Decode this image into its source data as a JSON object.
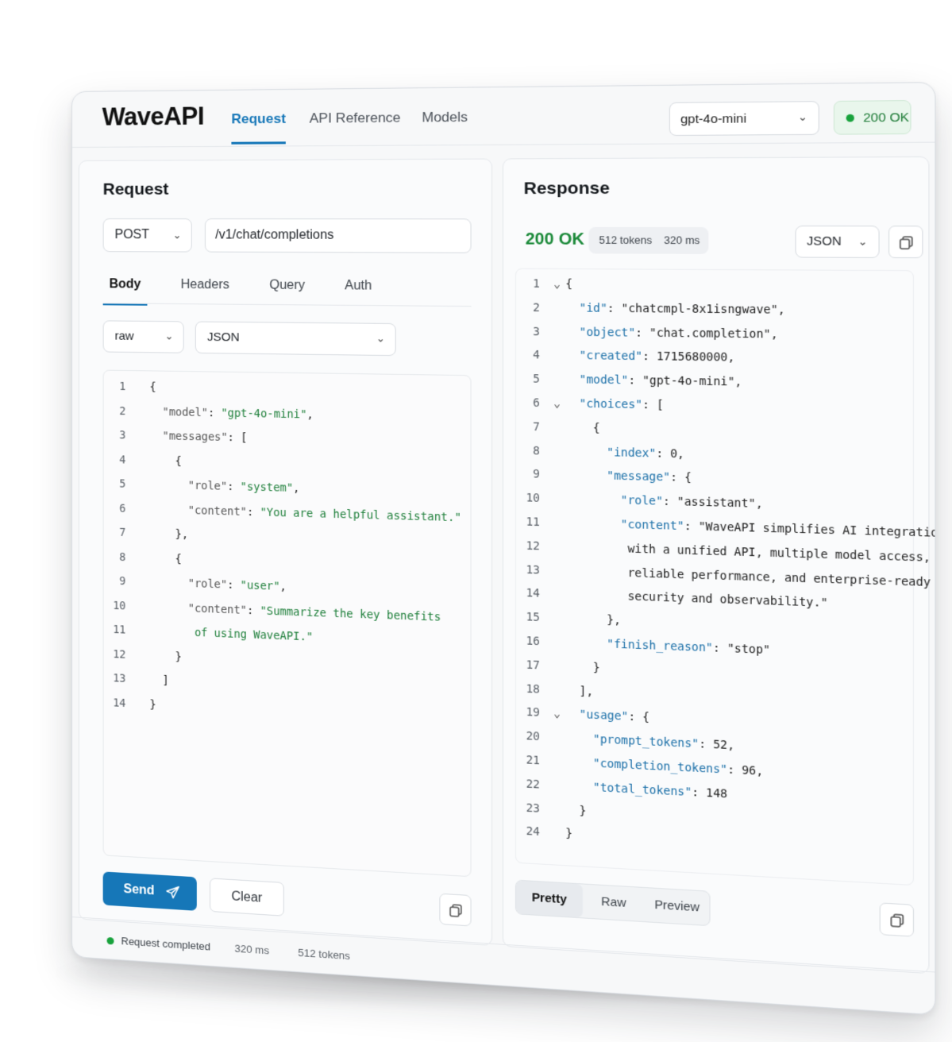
{
  "app": {
    "logo": "WaveAPI"
  },
  "nav": {
    "tabs": [
      {
        "label": "Request"
      },
      {
        "label": "API Reference"
      },
      {
        "label": "Models"
      }
    ]
  },
  "header": {
    "model": "gpt-4o-mini",
    "status": "200 OK"
  },
  "request": {
    "title": "Request",
    "method": "POST",
    "endpoint": "/v1/chat/completions",
    "tabs": [
      {
        "label": "Body"
      },
      {
        "label": "Headers"
      },
      {
        "label": "Query"
      },
      {
        "label": "Auth"
      }
    ],
    "body_mode": "raw",
    "body_format": "JSON",
    "code": [
      {
        "n": "1",
        "parts": [
          {
            "t": "{",
            "c": "p"
          }
        ],
        "indent": 0
      },
      {
        "n": "2",
        "parts": [
          {
            "t": "\"model\"",
            "c": "kg"
          },
          {
            "t": ": ",
            "c": "p"
          },
          {
            "t": "\"gpt-4o-mini\"",
            "c": "s"
          },
          {
            "t": ",",
            "c": "p"
          }
        ],
        "indent": 1
      },
      {
        "n": "3",
        "parts": [
          {
            "t": "\"messages\"",
            "c": "kg"
          },
          {
            "t": ": [",
            "c": "p"
          }
        ],
        "indent": 1
      },
      {
        "n": "4",
        "parts": [
          {
            "t": "{",
            "c": "p"
          }
        ],
        "indent": 2
      },
      {
        "n": "5",
        "parts": [
          {
            "t": "\"role\"",
            "c": "kg"
          },
          {
            "t": ": ",
            "c": "p"
          },
          {
            "t": "\"system\"",
            "c": "s"
          },
          {
            "t": ",",
            "c": "p"
          }
        ],
        "indent": 3
      },
      {
        "n": "6",
        "parts": [
          {
            "t": "\"content\"",
            "c": "kg"
          },
          {
            "t": ": ",
            "c": "p"
          },
          {
            "t": "\"You are a helpful assistant.\"",
            "c": "s"
          }
        ],
        "indent": 3
      },
      {
        "n": "7",
        "parts": [
          {
            "t": "},",
            "c": "p"
          }
        ],
        "indent": 2
      },
      {
        "n": "8",
        "parts": [
          {
            "t": "{",
            "c": "p"
          }
        ],
        "indent": 2
      },
      {
        "n": "9",
        "parts": [
          {
            "t": "\"role\"",
            "c": "kg"
          },
          {
            "t": ": ",
            "c": "p"
          },
          {
            "t": "\"user\"",
            "c": "s"
          },
          {
            "t": ",",
            "c": "p"
          }
        ],
        "indent": 3
      },
      {
        "n": "10",
        "parts": [
          {
            "t": "\"content\"",
            "c": "kg"
          },
          {
            "t": ": ",
            "c": "p"
          },
          {
            "t": "\"Summarize the key benefits",
            "c": "s"
          }
        ],
        "indent": 3
      },
      {
        "n": "11",
        "parts": [
          {
            "t": " of using WaveAPI.\"",
            "c": "s"
          }
        ],
        "indent": 3
      },
      {
        "n": "12",
        "parts": [
          {
            "t": "}",
            "c": "p"
          }
        ],
        "indent": 2
      },
      {
        "n": "13",
        "parts": [
          {
            "t": "]",
            "c": "p"
          }
        ],
        "indent": 1
      },
      {
        "n": "14",
        "parts": [
          {
            "t": "}",
            "c": "p"
          }
        ],
        "indent": 0
      }
    ],
    "send_label": "Send",
    "clear_label": "Clear"
  },
  "response": {
    "title": "Response",
    "status": "200 OK",
    "tokens": "512 tokens",
    "time": "320 ms",
    "format": "JSON",
    "code": [
      {
        "n": "1",
        "fold": "⌄",
        "parts": [
          {
            "t": "{",
            "c": "p"
          }
        ],
        "indent": 0
      },
      {
        "n": "2",
        "parts": [
          {
            "t": "\"id\"",
            "c": "k"
          },
          {
            "t": ": ",
            "c": "p"
          },
          {
            "t": "\"chatcmpl-8x1isngwave\"",
            "c": "p"
          },
          {
            "t": ",",
            "c": "p"
          }
        ],
        "indent": 1
      },
      {
        "n": "3",
        "parts": [
          {
            "t": "\"object\"",
            "c": "k"
          },
          {
            "t": ": ",
            "c": "p"
          },
          {
            "t": "\"chat.completion\"",
            "c": "p"
          },
          {
            "t": ",",
            "c": "p"
          }
        ],
        "indent": 1
      },
      {
        "n": "4",
        "parts": [
          {
            "t": "\"created\"",
            "c": "k"
          },
          {
            "t": ": 1715680000,",
            "c": "p"
          }
        ],
        "indent": 1
      },
      {
        "n": "5",
        "parts": [
          {
            "t": "\"model\"",
            "c": "k"
          },
          {
            "t": ": ",
            "c": "p"
          },
          {
            "t": "\"gpt-4o-mini\"",
            "c": "p"
          },
          {
            "t": ",",
            "c": "p"
          }
        ],
        "indent": 1
      },
      {
        "n": "6",
        "fold": "⌄",
        "parts": [
          {
            "t": "\"choices\"",
            "c": "k"
          },
          {
            "t": ": [",
            "c": "p"
          }
        ],
        "indent": 1
      },
      {
        "n": "7",
        "parts": [
          {
            "t": "{",
            "c": "p"
          }
        ],
        "indent": 2
      },
      {
        "n": "8",
        "parts": [
          {
            "t": "\"index\"",
            "c": "k"
          },
          {
            "t": ": 0,",
            "c": "p"
          }
        ],
        "indent": 3
      },
      {
        "n": "9",
        "parts": [
          {
            "t": "\"message\"",
            "c": "k"
          },
          {
            "t": ": {",
            "c": "p"
          }
        ],
        "indent": 3
      },
      {
        "n": "10",
        "parts": [
          {
            "t": "\"role\"",
            "c": "k"
          },
          {
            "t": ": ",
            "c": "p"
          },
          {
            "t": "\"assistant\"",
            "c": "p"
          },
          {
            "t": ",",
            "c": "p"
          }
        ],
        "indent": 4
      },
      {
        "n": "11",
        "parts": [
          {
            "t": "\"content\"",
            "c": "k"
          },
          {
            "t": ": ",
            "c": "p"
          },
          {
            "t": "\"WaveAPI simplifies AI integration",
            "c": "p"
          }
        ],
        "indent": 4
      },
      {
        "n": "12",
        "parts": [
          {
            "t": " with a unified API, multiple model access,",
            "c": "p"
          }
        ],
        "indent": 4
      },
      {
        "n": "13",
        "parts": [
          {
            "t": " reliable performance, and enterprise-ready",
            "c": "p"
          }
        ],
        "indent": 4
      },
      {
        "n": "14",
        "parts": [
          {
            "t": " security and observability.\"",
            "c": "p"
          }
        ],
        "indent": 4
      },
      {
        "n": "15",
        "parts": [
          {
            "t": "},",
            "c": "p"
          }
        ],
        "indent": 3
      },
      {
        "n": "16",
        "parts": [
          {
            "t": "\"finish_reason\"",
            "c": "k"
          },
          {
            "t": ": ",
            "c": "p"
          },
          {
            "t": "\"stop\"",
            "c": "p"
          }
        ],
        "indent": 3
      },
      {
        "n": "17",
        "parts": [
          {
            "t": "}",
            "c": "p"
          }
        ],
        "indent": 2
      },
      {
        "n": "18",
        "parts": [
          {
            "t": "],",
            "c": "p"
          }
        ],
        "indent": 1
      },
      {
        "n": "19",
        "fold": "⌄",
        "parts": [
          {
            "t": "\"usage\"",
            "c": "k"
          },
          {
            "t": ": {",
            "c": "p"
          }
        ],
        "indent": 1
      },
      {
        "n": "20",
        "parts": [
          {
            "t": "\"prompt_tokens\"",
            "c": "k"
          },
          {
            "t": ": 52,",
            "c": "p"
          }
        ],
        "indent": 2
      },
      {
        "n": "21",
        "parts": [
          {
            "t": "\"completion_tokens\"",
            "c": "k"
          },
          {
            "t": ": 96,",
            "c": "p"
          }
        ],
        "indent": 2
      },
      {
        "n": "22",
        "parts": [
          {
            "t": "\"total_tokens\"",
            "c": "k"
          },
          {
            "t": ": 148",
            "c": "p"
          }
        ],
        "indent": 2
      },
      {
        "n": "23",
        "parts": [
          {
            "t": "}",
            "c": "p"
          }
        ],
        "indent": 1
      },
      {
        "n": "24",
        "parts": [
          {
            "t": "}",
            "c": "p"
          }
        ],
        "indent": 0
      }
    ],
    "views": [
      {
        "label": "Pretty"
      },
      {
        "label": "Raw"
      },
      {
        "label": "Preview"
      }
    ]
  },
  "statusbar": {
    "message": "Request completed",
    "time": "320 ms",
    "tokens": "512 tokens"
  },
  "colors": {
    "accent": "#1677b8",
    "success": "#1c8a3a"
  }
}
